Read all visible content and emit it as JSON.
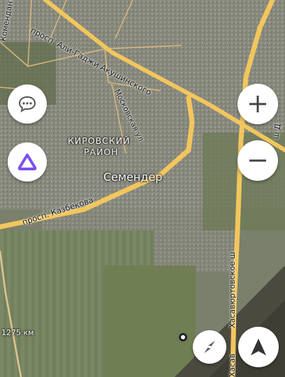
{
  "map": {
    "place_label": "Семендер",
    "district_line1": "КИРОВСКИЙ",
    "district_line2": "РАЙОН",
    "streets": {
      "ali_gadzhi": "просп. Али-Гаджи Акушинского",
      "moskovskaya": "Московская ул",
      "kazbekova": "просп. Казбекова",
      "khasavyurt": "Хасавюртовское ш",
      "khasav_bottom": "Хасав",
      "komendantskaya": "Комендант",
      "d_edge": "ш Д"
    },
    "km_marker": "1275 км"
  },
  "controls": {
    "chat_icon": "speech-bubble-icon",
    "alice_icon": "alice-triangle-icon",
    "zoom_in_icon": "plus-icon",
    "zoom_out_icon": "minus-icon",
    "compass_icon": "compass-icon",
    "navigate_icon": "navigation-arrow-icon"
  },
  "colors": {
    "road": "#f2c65e",
    "alice_accent": "#7b4ff0"
  }
}
